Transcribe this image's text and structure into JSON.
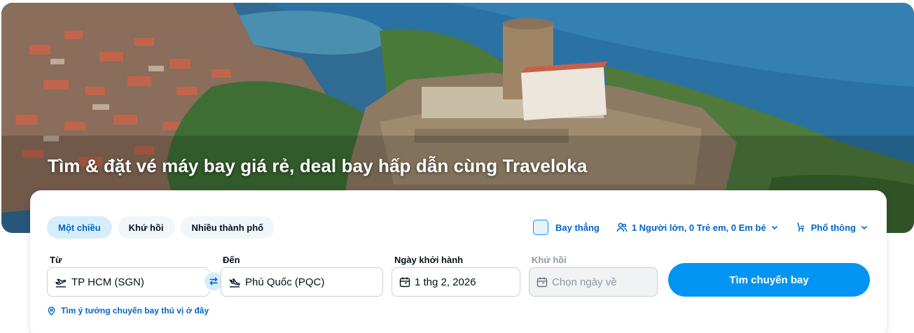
{
  "hero": {
    "headline": "Tìm & đặt vé máy bay giá rẻ, deal bay hấp dẫn cùng Traveloka"
  },
  "search": {
    "trip_types": [
      {
        "label": "Một chiều",
        "active": true
      },
      {
        "label": "Khứ hồi",
        "active": false
      },
      {
        "label": "Nhiều thành phố",
        "active": false
      }
    ],
    "direct_flight_label": "Bay thẳng",
    "direct_flight_checked": false,
    "passengers_label": "1 Người lớn, 0 Trẻ em, 0 Em bé",
    "cabin_class_label": "Phổ thông",
    "from": {
      "label": "Từ",
      "value": "TP HCM (SGN)"
    },
    "to": {
      "label": "Đến",
      "value": "Phú Quốc (PQC)"
    },
    "departure": {
      "label": "Ngày khởi hành",
      "value": "1 thg 2, 2026"
    },
    "return": {
      "label": "Khứ hồi",
      "placeholder": "Chọn ngày về"
    },
    "submit_label": "Tìm chuyến bay",
    "ideas_link": "Tìm ý tưởng chuyến bay thú vị ở đây"
  },
  "colors": {
    "primary": "#0194f3",
    "link": "#0264c8",
    "chip_active_bg": "#d6edfc",
    "text": "#03121a"
  },
  "icons": {
    "direct_checkbox": "checkbox-icon",
    "passengers": "people-icon",
    "cabin": "seat-icon",
    "chevron": "chevron-down-icon",
    "takeoff": "plane-takeoff-icon",
    "landing": "plane-landing-icon",
    "swap": "swap-icon",
    "calendar": "calendar-icon",
    "location": "location-pin-icon"
  }
}
